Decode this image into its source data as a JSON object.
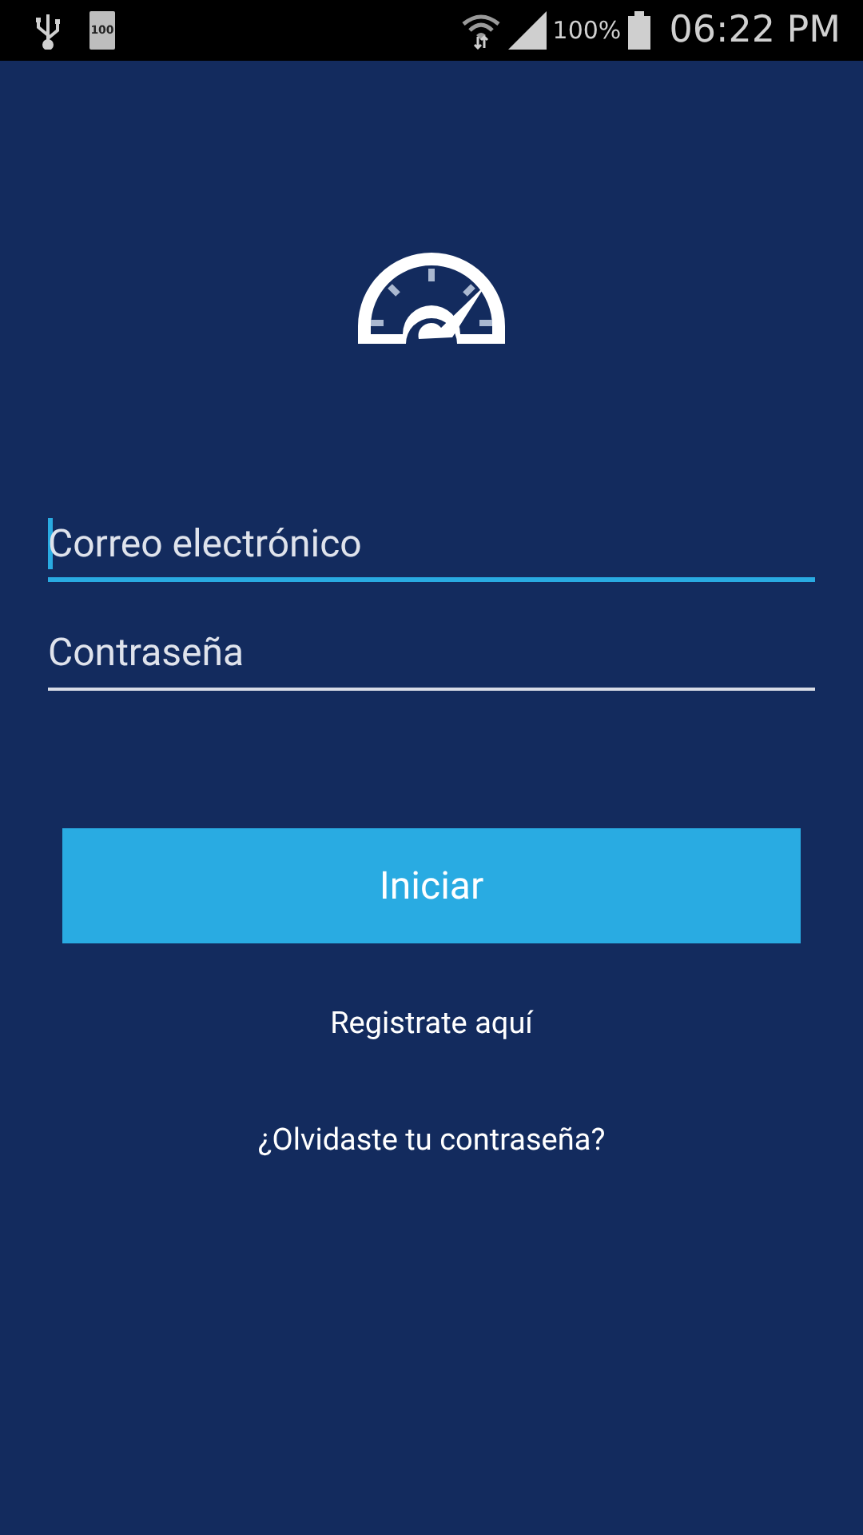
{
  "status_bar": {
    "battery_notification": "100",
    "battery_percent": "100%",
    "time": "06:22 PM"
  },
  "fields": [
    {
      "placeholder": "Correo electrónico",
      "selected": true
    },
    {
      "placeholder": "Contraseña",
      "selected": false
    }
  ],
  "login_button": "Iniciar",
  "links": [
    "Registrate aquí",
    "¿Olvidaste tu contraseña?"
  ]
}
